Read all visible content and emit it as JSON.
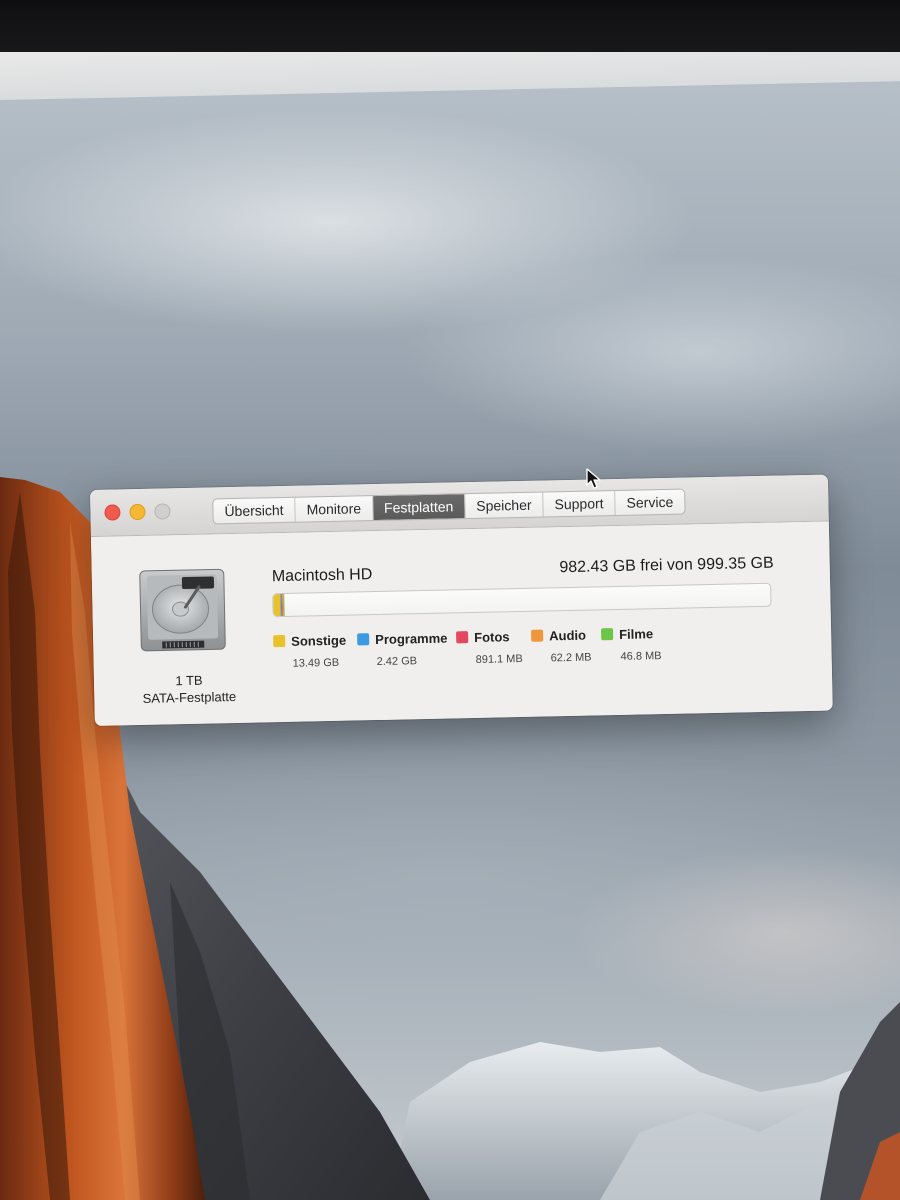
{
  "window": {
    "tabs": [
      {
        "label": "Übersicht",
        "active": false
      },
      {
        "label": "Monitore",
        "active": false
      },
      {
        "label": "Festplatten",
        "active": true
      },
      {
        "label": "Speicher",
        "active": false
      },
      {
        "label": "Support",
        "active": false
      },
      {
        "label": "Service",
        "active": false
      }
    ]
  },
  "disk": {
    "icon": "hard-drive-icon",
    "size_label": "1 TB",
    "type_label": "SATA-Festplatte",
    "volume_name": "Macintosh HD",
    "free_text": "982.43 GB frei von 999.35 GB",
    "free_gb": 982.43,
    "total_gb": 999.35
  },
  "storage": {
    "categories": [
      {
        "name": "Sonstige",
        "size": "13.49 GB",
        "gb": 13.49,
        "color": "#e8c22a"
      },
      {
        "name": "Programme",
        "size": "2.42 GB",
        "gb": 2.42,
        "color": "#3c9be0"
      },
      {
        "name": "Fotos",
        "size": "891.1 MB",
        "gb": 0.8911,
        "color": "#e44760"
      },
      {
        "name": "Audio",
        "size": "62.2 MB",
        "gb": 0.0622,
        "color": "#f0963a"
      },
      {
        "name": "Filme",
        "size": "46.8 MB",
        "gb": 0.0468,
        "color": "#6cc64a"
      }
    ]
  },
  "colors": {
    "close": "#f05a4f",
    "minimize": "#f7b733",
    "zoom": "#d0cfcd",
    "active_tab": "#5f5f5f"
  }
}
